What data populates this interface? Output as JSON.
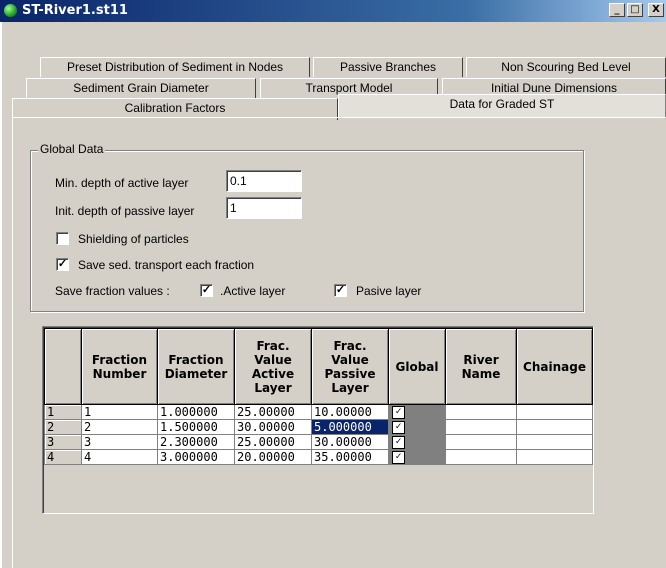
{
  "window": {
    "title": "ST-River1.st11",
    "minimize": "_",
    "maximize": "□",
    "close": "X"
  },
  "tabs": {
    "row1": [
      "Preset Distribution of Sediment in Nodes",
      "Passive Branches",
      "Non Scouring Bed Level"
    ],
    "row2": [
      "Sediment Grain Diameter",
      "Transport Model",
      "Initial Dune Dimensions"
    ],
    "row3": [
      "Calibration Factors",
      "Data for Graded ST"
    ],
    "active": "Data for Graded ST"
  },
  "global_data": {
    "label": "Global Data",
    "min_depth_label": "Min. depth of active layer",
    "min_depth_value": "0.1",
    "init_depth_label": "Init. depth of passive layer",
    "init_depth_value": "1",
    "shielding_label": "Shielding of particles",
    "shielding_checked": false,
    "save_each_label": "Save sed. transport each fraction",
    "save_each_checked": true,
    "save_fraction_label": "Save fraction values :",
    "active_layer_label": ".Active layer",
    "active_layer_checked": true,
    "passive_layer_label": "Pasive layer",
    "passive_layer_checked": true
  },
  "grid": {
    "headers": [
      "Fraction Number",
      "Fraction Diameter",
      "Frac. Value Active Layer",
      "Frac. Value Passive Layer",
      "Global",
      "River Name",
      "Chainage"
    ],
    "rows": [
      {
        "idx": "1",
        "num": "1",
        "diam": "1.000000",
        "active": "25.00000",
        "passive": "10.00000",
        "global": true,
        "river": "",
        "chainage": ""
      },
      {
        "idx": "2",
        "num": "2",
        "diam": "1.500000",
        "active": "30.00000",
        "passive": "5.000000",
        "global": true,
        "river": "",
        "chainage": ""
      },
      {
        "idx": "3",
        "num": "3",
        "diam": "2.300000",
        "active": "25.00000",
        "passive": "30.00000",
        "global": true,
        "river": "",
        "chainage": ""
      },
      {
        "idx": "4",
        "num": "4",
        "diam": "3.000000",
        "active": "20.00000",
        "passive": "35.00000",
        "global": true,
        "river": "",
        "chainage": ""
      }
    ],
    "selected_cell": "row 2 passive",
    "check_glyph": "✓"
  }
}
